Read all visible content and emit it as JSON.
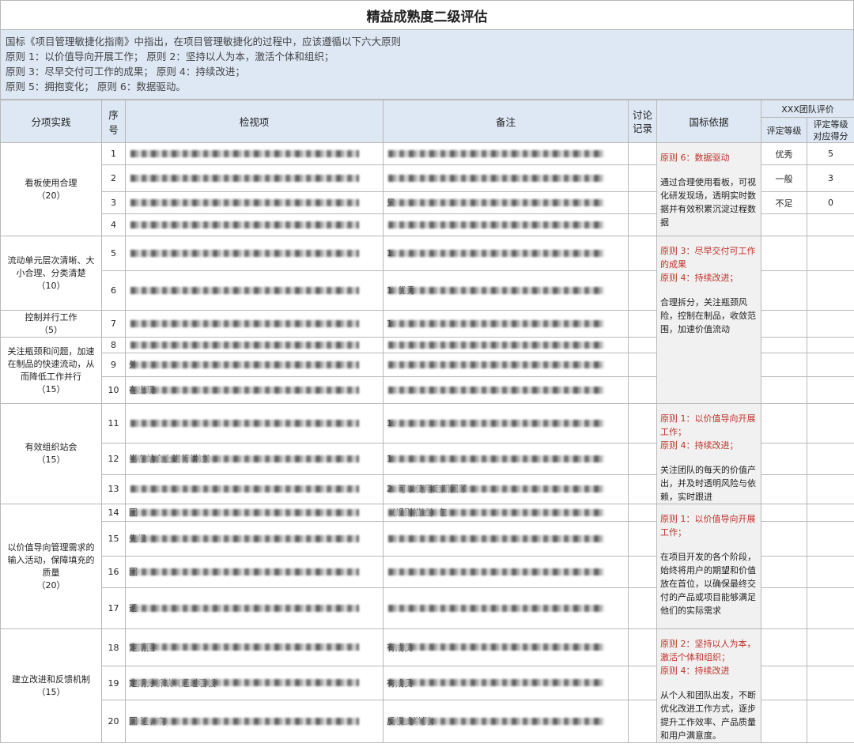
{
  "title": "精益成熟度二级评估",
  "intro": [
    "国标《项目管理敏捷化指南》中指出，在项目管理敏捷化的过程中，应该遵循以下六大原则",
    "原则 1：以价值导向开展工作；     原则 2：坚持以人为本，激活个体和组织；",
    "原则 3：尽早交付可工作的成果；     原则 4：持续改进；",
    "原则 5：拥抱变化；     原则 6：数据驱动。"
  ],
  "headers": {
    "category": "分项实践",
    "index": "序号",
    "item": "检视项",
    "note": "备注",
    "discuss": "讨论记录",
    "basis": "国标依据",
    "team_eval": "XXX团队评价",
    "grade": "评定等级",
    "grade_score": "评定等级对应得分"
  },
  "categories": [
    {
      "label": "看板使用合理",
      "score": "（20）"
    },
    {
      "label": "流动单元层次清晰、大小合理、分类清楚",
      "score": "（10）"
    },
    {
      "label": "控制并行工作",
      "score": "（5）"
    },
    {
      "label": "关注瓶颈和问题，加速在制品的快速流动，从而降低工作并行",
      "score": "（15）"
    },
    {
      "label": "有效组织站会",
      "score": "（15）"
    },
    {
      "label": "以价值导向管理需求的输入活动，保障填充的质量",
      "score": "（20）"
    },
    {
      "label": "建立改进和反馈机制",
      "score": "（15）"
    }
  ],
  "rows": [
    {
      "n": "1",
      "item": "",
      "note": ""
    },
    {
      "n": "2",
      "item": "",
      "note": ""
    },
    {
      "n": "3",
      "item": "",
      "note": "只"
    },
    {
      "n": "4",
      "item": "",
      "note": ""
    },
    {
      "n": "5",
      "item": "",
      "note": "1."
    },
    {
      "n": "6",
      "item": "",
      "note": "1.  优秀"
    },
    {
      "n": "7",
      "item": "",
      "note": "1."
    },
    {
      "n": "8",
      "item": "",
      "note": ""
    },
    {
      "n": "9",
      "item": "外",
      "note": ""
    },
    {
      "n": "10",
      "item": "在出现",
      "note": ""
    },
    {
      "n": "11",
      "item": "",
      "note": "1."
    },
    {
      "n": "12",
      "item": "当在站会上进行讲述）",
      "note": "1."
    },
    {
      "n": "13",
      "item": "",
      "note": "2. 可以使用定期回顾"
    },
    {
      "n": "14",
      "item": "团",
      "note": "（规则描述）包"
    },
    {
      "n": "15",
      "item": "先级",
      "note": ""
    },
    {
      "n": "16",
      "item": "团",
      "note": ""
    },
    {
      "n": "17",
      "item": "透",
      "note": ""
    },
    {
      "n": "18",
      "item": "定期回",
      "note": "有成员"
    },
    {
      "n": "19",
      "item": "定期分析缺（通过看板",
      "note": "有成员"
    },
    {
      "n": "20",
      "item": "回  进，有",
      "note": "反模式举例："
    }
  ],
  "basis": [
    {
      "red": [
        "原则 6：数据驱动"
      ],
      "desc": "通过合理使用看板，可视化研发现场，透明实时数据并有效积累沉淀过程数据"
    },
    {
      "red": [
        "原则 3：尽早交付可工作的成果",
        "原则 4：持续改进；"
      ],
      "desc": "合理拆分，关注瓶颈风险，控制在制品，收敛范围，加速价值流动"
    },
    {
      "red": [
        "原则 1：以价值导向开展工作；",
        "原则 4：持续改进；"
      ],
      "desc": "关注团队的每天的价值产出，并及时透明风险与依赖，实时跟进"
    },
    {
      "red": [
        "原则 1：以价值导向开展工作；"
      ],
      "desc": "在项目开发的各个阶段，始终将用户的期望和价值放在首位，以确保最终交付的产品或项目能够满足他们的实际需求"
    },
    {
      "red": [
        "原则 2：坚持以人为本，激活个体和组织；",
        "原则 4：持续改进"
      ],
      "desc": "从个人和团队出发，不断优化改进工作方式，逐步提升工作效率、产品质量和用户满意度。"
    }
  ],
  "grades": [
    {
      "grade": "优秀",
      "score": "5"
    },
    {
      "grade": "一般",
      "score": "3"
    },
    {
      "grade": "不足",
      "score": "0"
    }
  ]
}
